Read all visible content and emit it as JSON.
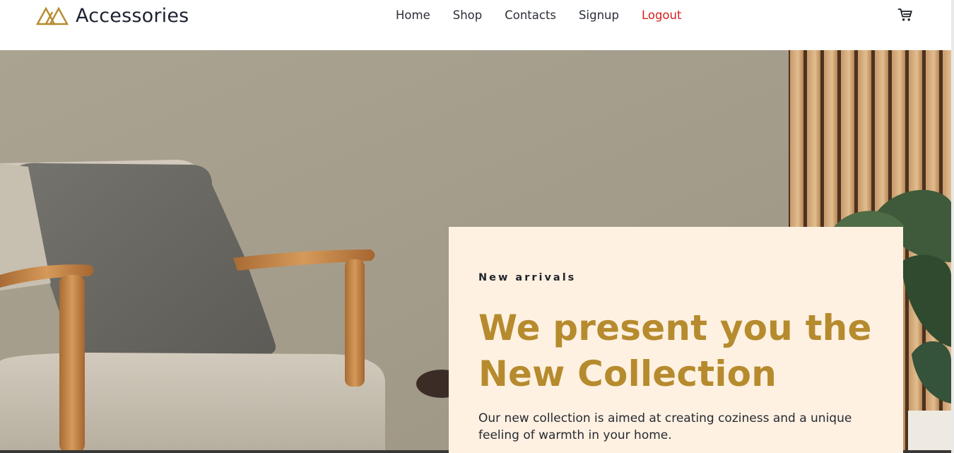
{
  "brand": {
    "name": "Accessories",
    "logo_icon": "stacked-triangles-logo-icon",
    "accent_color": "#b68b2e"
  },
  "nav": {
    "items": [
      {
        "label": "Home"
      },
      {
        "label": "Shop"
      },
      {
        "label": "Contacts"
      },
      {
        "label": "Signup"
      },
      {
        "label": "Logout",
        "color": "#d61f1f"
      }
    ]
  },
  "cart": {
    "icon": "cart-icon"
  },
  "hero": {
    "image_subject": "armchair-with-cushion-and-plant-photo",
    "eyebrow": "New arrivals",
    "headline_line1": "We present you the",
    "headline_line2": "New Collection",
    "description": "Our new collection is aimed at creating coziness and a unique feeling of warmth in your home.",
    "card_color": "#fff1e2",
    "headline_color": "#b68b2e"
  }
}
